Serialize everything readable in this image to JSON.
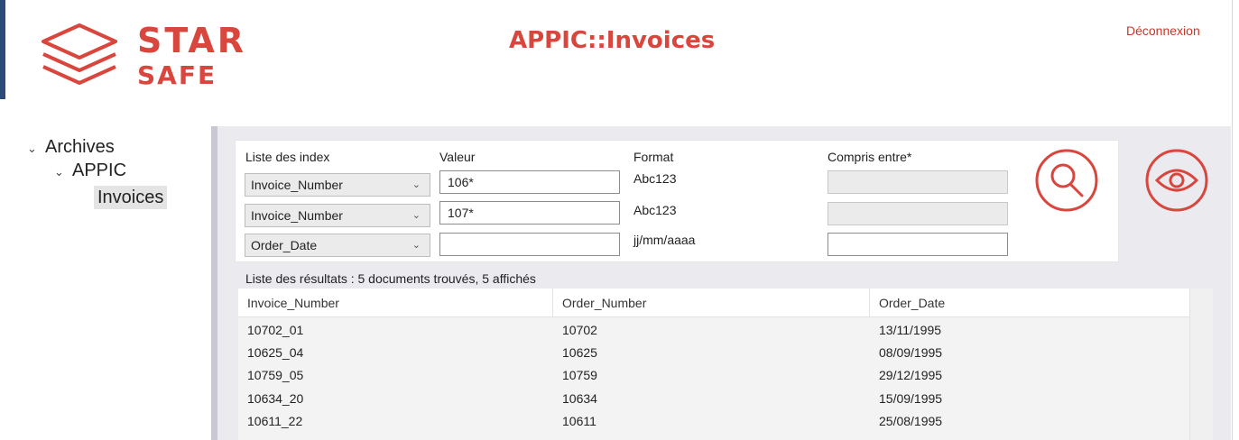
{
  "header": {
    "logo_top": "STAR",
    "logo_bottom": "SAFE",
    "title": "APPIC::Invoices",
    "logout_label": "Déconnexion"
  },
  "tree": {
    "items": [
      {
        "label": "Archives",
        "expanded": true
      },
      {
        "label": "APPIC",
        "expanded": true
      },
      {
        "label": "Invoices",
        "selected": true
      }
    ]
  },
  "filters": {
    "headers": {
      "index": "Liste des index",
      "value": "Valeur",
      "format": "Format",
      "range": "Compris entre*"
    },
    "rows": [
      {
        "index": "Invoice_Number",
        "value": "106*",
        "format": "Abc123",
        "range_enabled": false
      },
      {
        "index": "Invoice_Number",
        "value": "107*",
        "format": "Abc123",
        "range_enabled": false
      },
      {
        "index": "Order_Date",
        "value": "",
        "format": "jj/mm/aaaa",
        "range_enabled": true
      }
    ]
  },
  "icons": {
    "search": "search-icon",
    "view": "eye-icon",
    "accent": "#d9463d"
  },
  "results": {
    "label": "Liste des résultats : 5 documents trouvés, 5 affichés",
    "columns": [
      "Invoice_Number",
      "Order_Number",
      "Order_Date"
    ],
    "rows": [
      [
        "10702_01",
        "10702",
        "13/11/1995"
      ],
      [
        "10625_04",
        "10625",
        "08/09/1995"
      ],
      [
        "10759_05",
        "10759",
        "29/12/1995"
      ],
      [
        "10634_20",
        "10634",
        "15/09/1995"
      ],
      [
        "10611_22",
        "10611",
        "25/08/1995"
      ]
    ]
  }
}
